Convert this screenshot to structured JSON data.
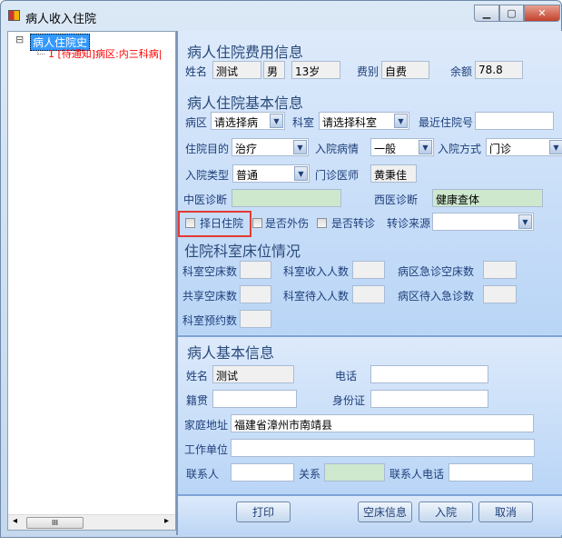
{
  "window": {
    "title": "病人收入住院",
    "minimize": "▁",
    "maximize": "▢",
    "close": "✕"
  },
  "tree": {
    "root": "病人住院史",
    "expander": "⊟",
    "child": "1 [待通知]病区:内三科病|"
  },
  "fee": {
    "title": "病人住院费用信息",
    "name_label": "姓名",
    "name": "测试",
    "sex": "男",
    "age": "13岁",
    "fee_type_label": "费别",
    "fee_type": "自费",
    "balance_label": "余额",
    "balance": "78.8"
  },
  "basic": {
    "title": "病人住院基本信息",
    "ward_label": "病区",
    "ward": "请选择病",
    "dept_label": "科室",
    "dept": "请选择科室",
    "last_no_label": "最近住院号",
    "last_no": "",
    "purpose_label": "住院目的",
    "purpose": "治疗",
    "condition_label": "入院病情",
    "condition": "一般",
    "mode_label": "入院方式",
    "mode": "门诊",
    "type_label": "入院类型",
    "type": "普通",
    "doctor_label": "门诊医师",
    "doctor": "黄秉佳",
    "tcm_label": "中医诊断",
    "tcm": "",
    "wm_label": "西医诊断",
    "wm": "健康查体",
    "choose_day_label": "择日住院",
    "trauma_label": "是否外伤",
    "transfer_label": "是否转诊",
    "transfer_src_label": "转诊来源",
    "transfer_src": ""
  },
  "beds": {
    "title": "住院科室床位情况",
    "l1": "科室空床数",
    "l2": "科室收入人数",
    "l3": "病区急诊空床数",
    "l4": "共享空床数",
    "l5": "科室待入人数",
    "l6": "病区待入急诊数",
    "l7": "科室预约数"
  },
  "patient": {
    "title": "病人基本信息",
    "name_label": "姓名",
    "name": "测试",
    "phone_label": "电话",
    "phone": "",
    "native_label": "籍贯",
    "native": "",
    "id_label": "身份证",
    "id": "",
    "address_label": "家庭地址",
    "address": "福建省漳州市南靖县",
    "work_label": "工作单位",
    "work": "",
    "contact_label": "联系人",
    "contact": "",
    "relation_label": "关系",
    "relation": "",
    "contact_phone_label": "联系人电话",
    "contact_phone": ""
  },
  "buttons": {
    "print": "打印",
    "beds": "空床信息",
    "admit": "入院",
    "cancel": "取消"
  },
  "scroll": {
    "left": "◂",
    "right": "▸",
    "grip": "III"
  },
  "colors": {
    "highlight": "#e53935",
    "tree_child": "#ff0000"
  }
}
